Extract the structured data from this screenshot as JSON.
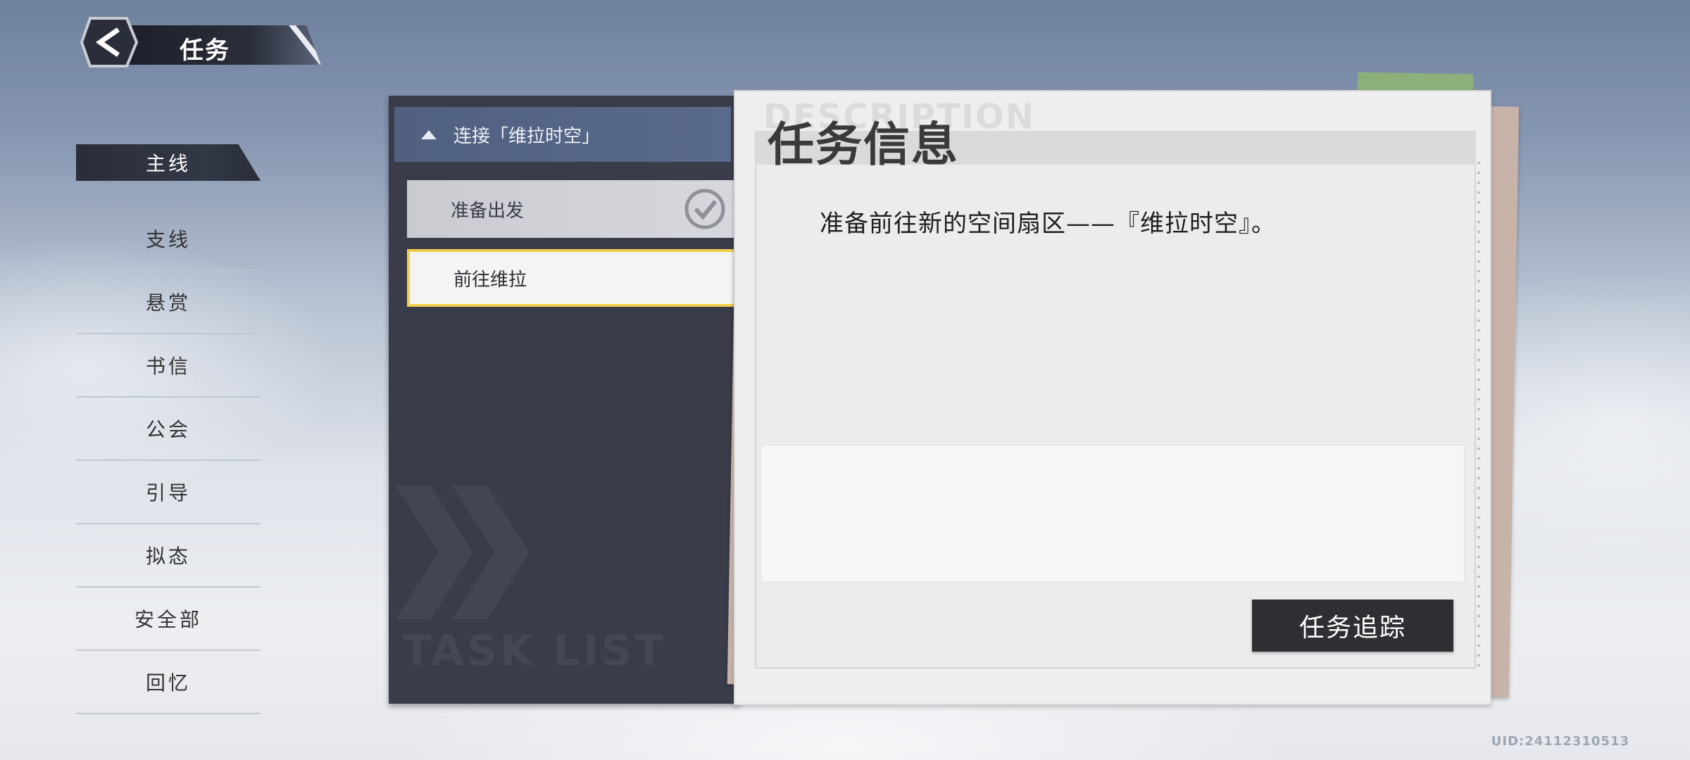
{
  "header": {
    "title": "任务",
    "back_icon": "chevron-left-icon"
  },
  "side_nav": {
    "items": [
      {
        "label": "主线",
        "active": true
      },
      {
        "label": "支线",
        "active": false
      },
      {
        "label": "悬赏",
        "active": false
      },
      {
        "label": "书信",
        "active": false
      },
      {
        "label": "公会",
        "active": false
      },
      {
        "label": "引导",
        "active": false
      },
      {
        "label": "拟态",
        "active": false
      },
      {
        "label": "安全部",
        "active": false
      },
      {
        "label": "回忆",
        "active": false
      }
    ]
  },
  "task_list": {
    "chapter": "连接「维拉时空」",
    "watermark": "TASK LIST",
    "tasks": [
      {
        "label": "准备出发",
        "status": "completed"
      },
      {
        "label": "前往维拉",
        "status": "current"
      }
    ]
  },
  "task_info": {
    "watermark": "DESCRIPTION",
    "title": "任务信息",
    "description": "准备前往新的空间扇区——『维拉时空』。",
    "track_button": "任务追踪"
  },
  "footer": {
    "uid": "UID:24112310513"
  },
  "colors": {
    "panel_bg": "#3a3c4a",
    "chapter_header": "#5a6a8c",
    "current_task_border": "#f2cf4a",
    "button_bg": "#2e2f34"
  }
}
